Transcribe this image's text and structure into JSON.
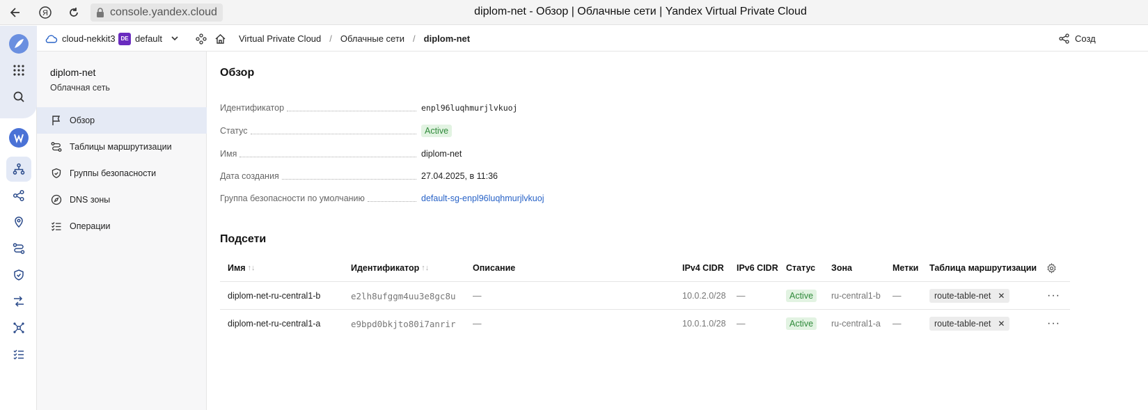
{
  "browser": {
    "url": "console.yandex.cloud",
    "tab_title": "diplom-net - Обзор | Облачные сети | Yandex Virtual Private Cloud"
  },
  "header": {
    "cloud": "cloud-nekkit3",
    "folder_badge": "DE",
    "folder": "default",
    "breadcrumbs": [
      "Virtual Private Cloud",
      "Облачные сети",
      "diplom-net"
    ],
    "create_label": "Созд"
  },
  "sidebar": {
    "title": "diplom-net",
    "subtitle": "Облачная сеть",
    "items": [
      {
        "label": "Обзор",
        "icon": "flag-icon",
        "active": true
      },
      {
        "label": "Таблицы маршрутизации",
        "icon": "route-icon",
        "active": false
      },
      {
        "label": "Группы безопасности",
        "icon": "shield-icon",
        "active": false
      },
      {
        "label": "DNS зоны",
        "icon": "compass-icon",
        "active": false
      },
      {
        "label": "Операции",
        "icon": "list-check-icon",
        "active": false
      }
    ]
  },
  "overview": {
    "title": "Обзор",
    "fields": [
      {
        "key": "Идентификатор",
        "value": "enpl96luqhmurjlvkuoj"
      },
      {
        "key": "Статус",
        "value": "Active"
      },
      {
        "key": "Имя",
        "value": "diplom-net"
      },
      {
        "key": "Дата создания",
        "value": "27.04.2025, в 11:36"
      },
      {
        "key": "Группа безопасности по умолчанию",
        "value": "default-sg-enpl96luqhmurjlvkuoj"
      }
    ]
  },
  "subnets": {
    "title": "Подсети",
    "columns": [
      "Имя",
      "Идентификатор",
      "Описание",
      "IPv4 CIDR",
      "IPv6 CIDR",
      "Статус",
      "Зона",
      "Метки",
      "Таблица маршрутизации"
    ],
    "rows": [
      {
        "name": "diplom-net-ru-central1-b",
        "id": "e2lh8ufggm4uu3e8gc8u",
        "description": "—",
        "ipv4": "10.0.2.0/28",
        "ipv6": "—",
        "status": "Active",
        "zone": "ru-central1-b",
        "labels": "—",
        "route_table": "route-table-net"
      },
      {
        "name": "diplom-net-ru-central1-a",
        "id": "e9bpd0bkjto80i7anrir",
        "description": "—",
        "ipv4": "10.0.1.0/28",
        "ipv6": "—",
        "status": "Active",
        "zone": "ru-central1-a",
        "labels": "—",
        "route_table": "route-table-net"
      }
    ]
  },
  "colors": {
    "accent": "#2762c7",
    "active_bg": "#e2f3e2",
    "active_text": "#2f8a3a",
    "brand_purple": "#6a2cbf"
  }
}
